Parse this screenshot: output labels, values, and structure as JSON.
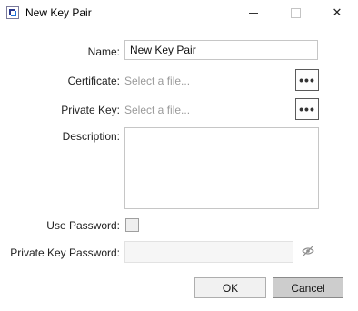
{
  "window": {
    "title": "New Key Pair",
    "icon": "key-pair-app-icon",
    "controls": [
      "minimize",
      "maximize",
      "close"
    ],
    "close_glyph": "✕"
  },
  "form": {
    "name_label": "Name:",
    "name_value": "New Key Pair",
    "certificate_label": "Certificate:",
    "certificate_placeholder": "Select a file...",
    "private_key_label": "Private Key:",
    "private_key_placeholder": "Select a file...",
    "browse_glyph": "•••",
    "description_label": "Description:",
    "description_value": "",
    "use_password_label": "Use Password:",
    "use_password_checked": false,
    "private_key_password_label": "Private Key Password:",
    "private_key_password_value": "",
    "password_toggle_icon": "eye-slash-icon"
  },
  "buttons": {
    "ok": "OK",
    "cancel": "Cancel"
  },
  "colors": {
    "accent_icon": "#1e6fd9",
    "cancel_bg": "#cdcdcd",
    "placeholder": "#9a9a9a"
  }
}
